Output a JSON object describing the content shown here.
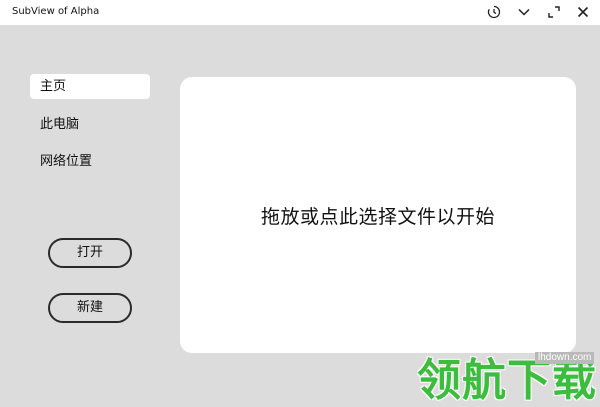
{
  "window": {
    "title": "SubView of Alpha",
    "controls": {
      "history_icon": "history-icon",
      "dropdown_icon": "chevron-down-icon",
      "fullscreen_icon": "fullscreen-icon",
      "close_icon": "close-icon"
    }
  },
  "sidebar": {
    "items": [
      {
        "label": "主页",
        "active": true
      },
      {
        "label": "此电脑",
        "active": false
      },
      {
        "label": "网络位置",
        "active": false
      }
    ],
    "buttons": {
      "open_label": "打开",
      "new_label": "新建"
    }
  },
  "main": {
    "dropzone_text": "拖放或点此选择文件以开始"
  },
  "watermark": {
    "domain": "lhdown.com",
    "text": "领航下载"
  },
  "colors": {
    "background": "#dcdcdc",
    "panel": "#ffffff",
    "watermark_green": "#3dbd3d"
  }
}
